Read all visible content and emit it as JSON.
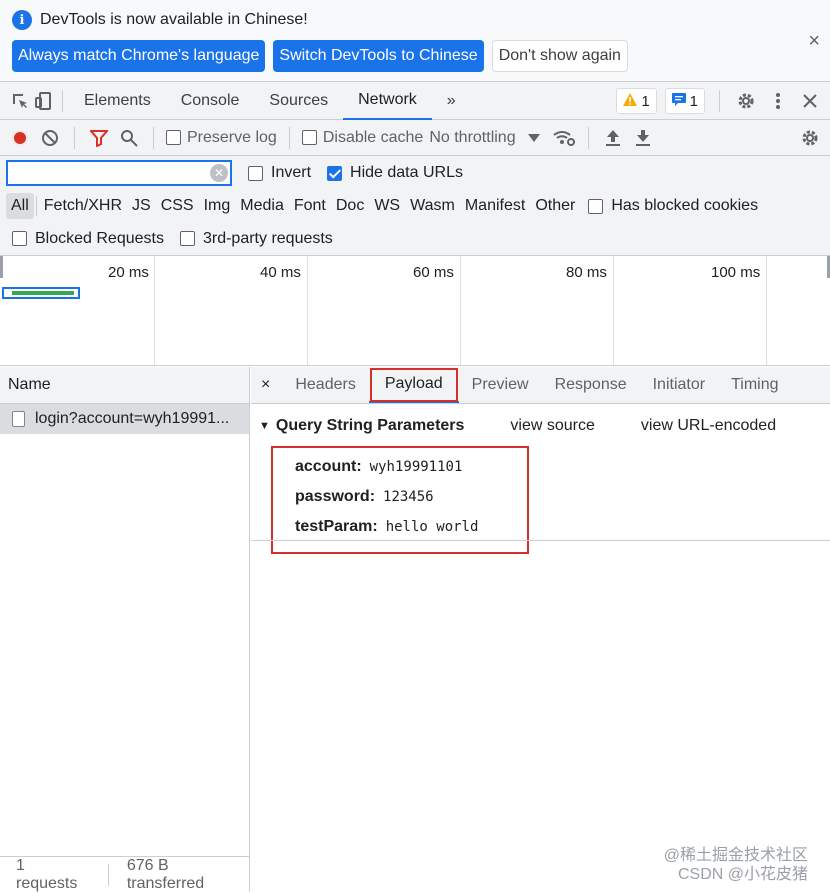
{
  "infobar": {
    "message": "DevTools is now available in Chinese!",
    "btn_match": "Always match Chrome's language",
    "btn_switch": "Switch DevTools to Chinese",
    "btn_dont_show": "Don't show again",
    "close": "×"
  },
  "tabs": {
    "items": [
      "Elements",
      "Console",
      "Sources",
      "Network"
    ],
    "more": "»",
    "warning_count": "1",
    "message_count": "1"
  },
  "toolbar": {
    "preserve_log": "Preserve log",
    "disable_cache": "Disable cache",
    "throttling": "No throttling"
  },
  "filter": {
    "placeholder": "",
    "invert": "Invert",
    "hide_data_urls": "Hide data URLs"
  },
  "types": [
    "All",
    "Fetch/XHR",
    "JS",
    "CSS",
    "Img",
    "Media",
    "Font",
    "Doc",
    "WS",
    "Wasm",
    "Manifest",
    "Other"
  ],
  "has_blocked_cookies": "Has blocked cookies",
  "blocked_requests": "Blocked Requests",
  "third_party": "3rd-party requests",
  "timeline": {
    "ticks": [
      "20 ms",
      "40 ms",
      "60 ms",
      "80 ms",
      "100 ms"
    ]
  },
  "requests": {
    "header": "Name",
    "items": [
      "login?account=wyh19991..."
    ]
  },
  "status": {
    "count": "1 requests",
    "transferred": "676 B transferred"
  },
  "detail": {
    "close": "×",
    "tabs": [
      "Headers",
      "Payload",
      "Preview",
      "Response",
      "Initiator",
      "Timing"
    ],
    "section_title": "Query String Parameters",
    "view_source": "view source",
    "view_url_encoded": "view URL-encoded",
    "params": [
      {
        "key": "account:",
        "value": "wyh19991101"
      },
      {
        "key": "password:",
        "value": "123456"
      },
      {
        "key": "testParam:",
        "value": "hello world"
      }
    ]
  },
  "watermark": {
    "line1": "@稀土掘金技术社区",
    "line2": "CSDN @小花皮猪"
  },
  "colors": {
    "accent": "#1a73e8",
    "highlight": "#d32f2f",
    "bar": "#34a853"
  }
}
